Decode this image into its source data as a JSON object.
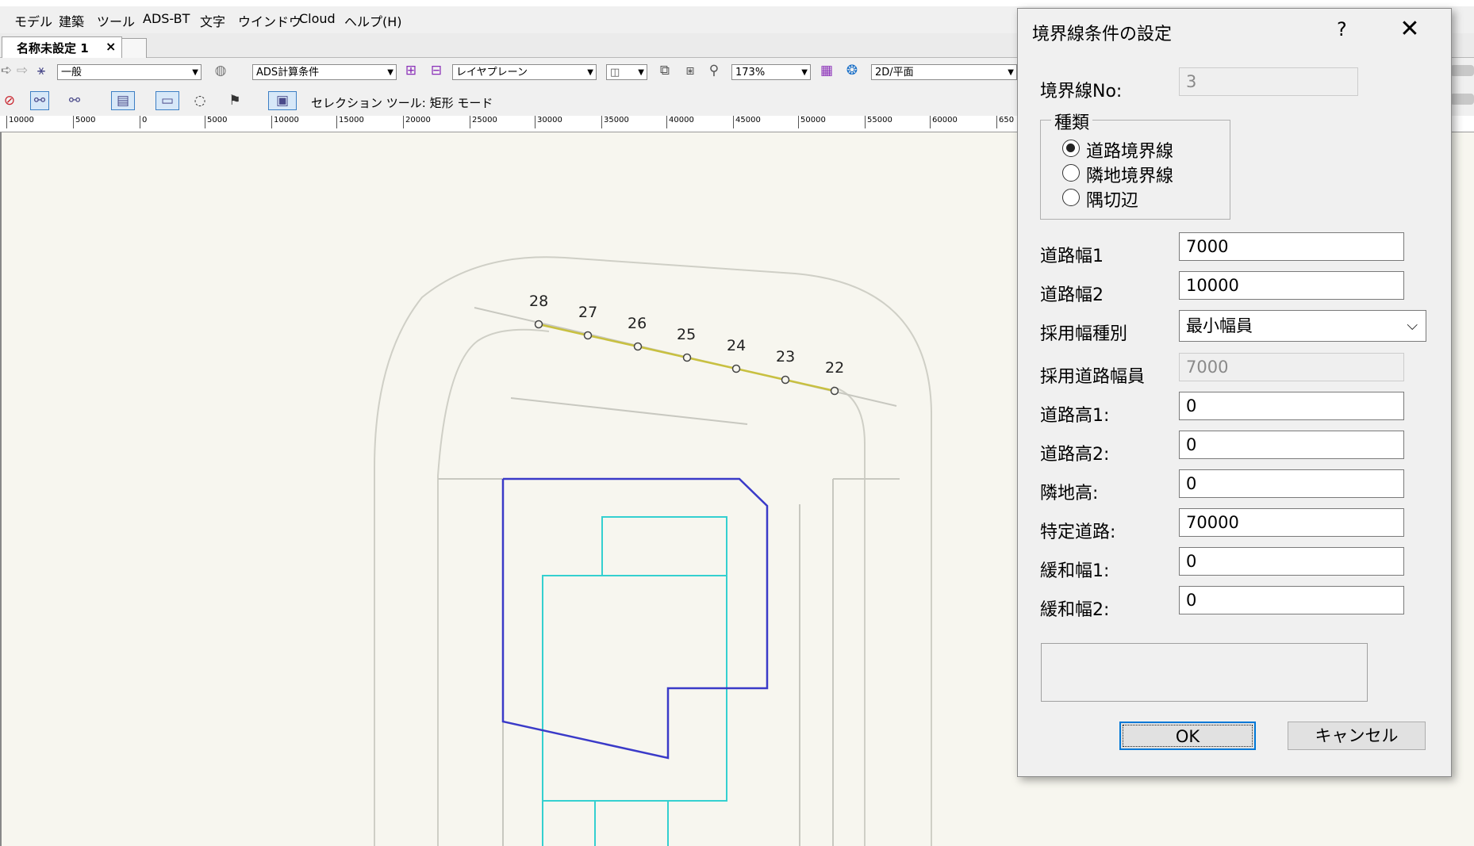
{
  "menu": [
    "モデル",
    "建築",
    "ツール",
    "ADS-BT",
    "文字",
    "ウインドウ",
    "Cloud",
    "ヘルプ(H)"
  ],
  "tabs": {
    "document": "名称未設定 1",
    "close": "×"
  },
  "toolbar1": {
    "class_combo": "一般",
    "design_layer_combo": "ADS計算条件",
    "layer_plane_combo": "レイヤプレーン",
    "zoom_combo": "173%",
    "view_combo": "2D/平面"
  },
  "toolbar2": {
    "mode_text": "セレクション ツール: 矩形 モード"
  },
  "ruler_labels": [
    "10000",
    "5000",
    "0",
    "5000",
    "10000",
    "15000",
    "20000",
    "25000",
    "30000",
    "35000",
    "40000",
    "45000",
    "50000",
    "55000",
    "60000",
    "650"
  ],
  "drawing": {
    "point_labels": [
      "28",
      "27",
      "26",
      "25",
      "24",
      "23",
      "22"
    ],
    "colors": {
      "boundary": "#c8c040",
      "site": "#3a3ac8",
      "building": "#34d0d0",
      "road": "#c8c8c0"
    }
  },
  "dialog": {
    "title": "境界線条件の設定",
    "help": "?",
    "close": "✕",
    "boundary_no_label": "境界線No:",
    "boundary_no_value": "3",
    "type_group_label": "種類",
    "type_options": [
      "道路境界線",
      "隣地境界線",
      "隅切辺"
    ],
    "type_selected": "道路境界線",
    "fields": [
      {
        "label": "道路幅1",
        "value": "7000"
      },
      {
        "label": "道路幅2",
        "value": "10000"
      }
    ],
    "adopt_type_label": "採用幅種別",
    "adopt_type_value": "最小幅員",
    "adopt_width_label": "採用道路幅員",
    "adopt_width_value": "7000",
    "fields2": [
      {
        "label": "道路高1:",
        "value": "0"
      },
      {
        "label": "道路高2:",
        "value": "0"
      },
      {
        "label": "隣地高:",
        "value": "0"
      },
      {
        "label": "特定道路:",
        "value": "70000"
      },
      {
        "label": "緩和幅1:",
        "value": "0"
      },
      {
        "label": "緩和幅2:",
        "value": "0"
      }
    ],
    "ok_label": "OK",
    "cancel_label": "キャンセル"
  }
}
